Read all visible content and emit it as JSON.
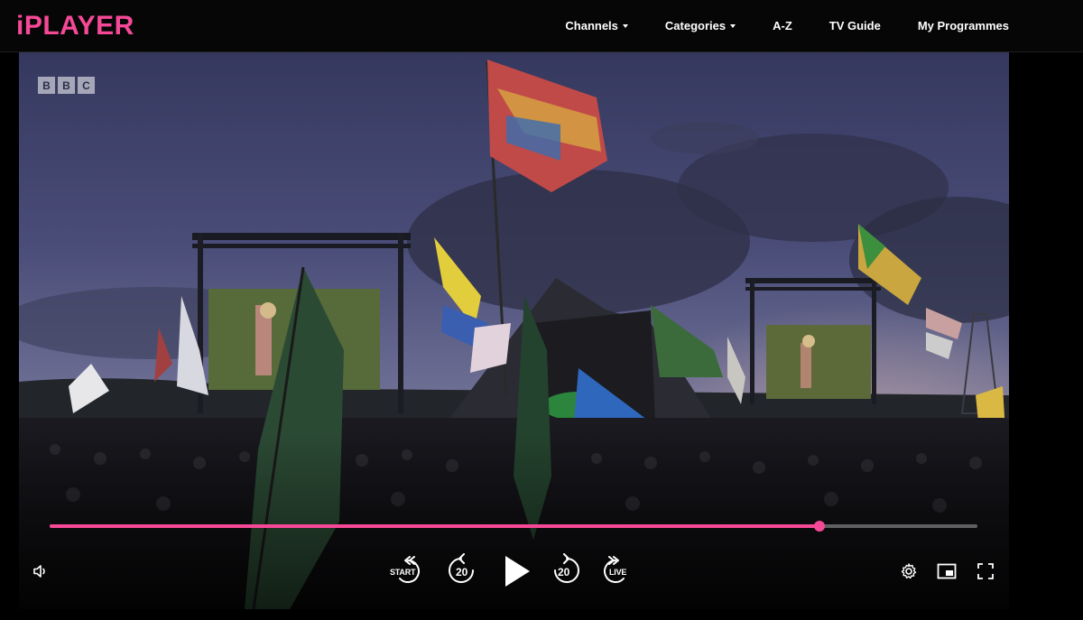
{
  "header": {
    "logo": "iPLAYER",
    "nav": [
      {
        "label": "Channels",
        "dropdown": true
      },
      {
        "label": "Categories",
        "dropdown": true
      },
      {
        "label": "A-Z",
        "dropdown": false
      },
      {
        "label": "TV Guide",
        "dropdown": false
      },
      {
        "label": "My Programmes",
        "dropdown": false
      }
    ]
  },
  "player": {
    "channel_watermark": [
      "B",
      "B",
      "C"
    ],
    "progress_fraction": 0.83,
    "controls": {
      "start_label": "START",
      "rewind_seconds": "20",
      "forward_seconds": "20",
      "live_label": "LIVE"
    },
    "icons": {
      "volume": "volume-icon",
      "start": "skip-to-start-icon",
      "rewind": "rewind-20-icon",
      "play": "play-icon",
      "forward": "forward-20-icon",
      "live": "skip-to-live-icon",
      "settings": "gear-icon",
      "pip": "picture-in-picture-icon",
      "fullscreen": "fullscreen-icon"
    }
  },
  "colors": {
    "brand_pink": "#f54997",
    "background": "#000000"
  }
}
